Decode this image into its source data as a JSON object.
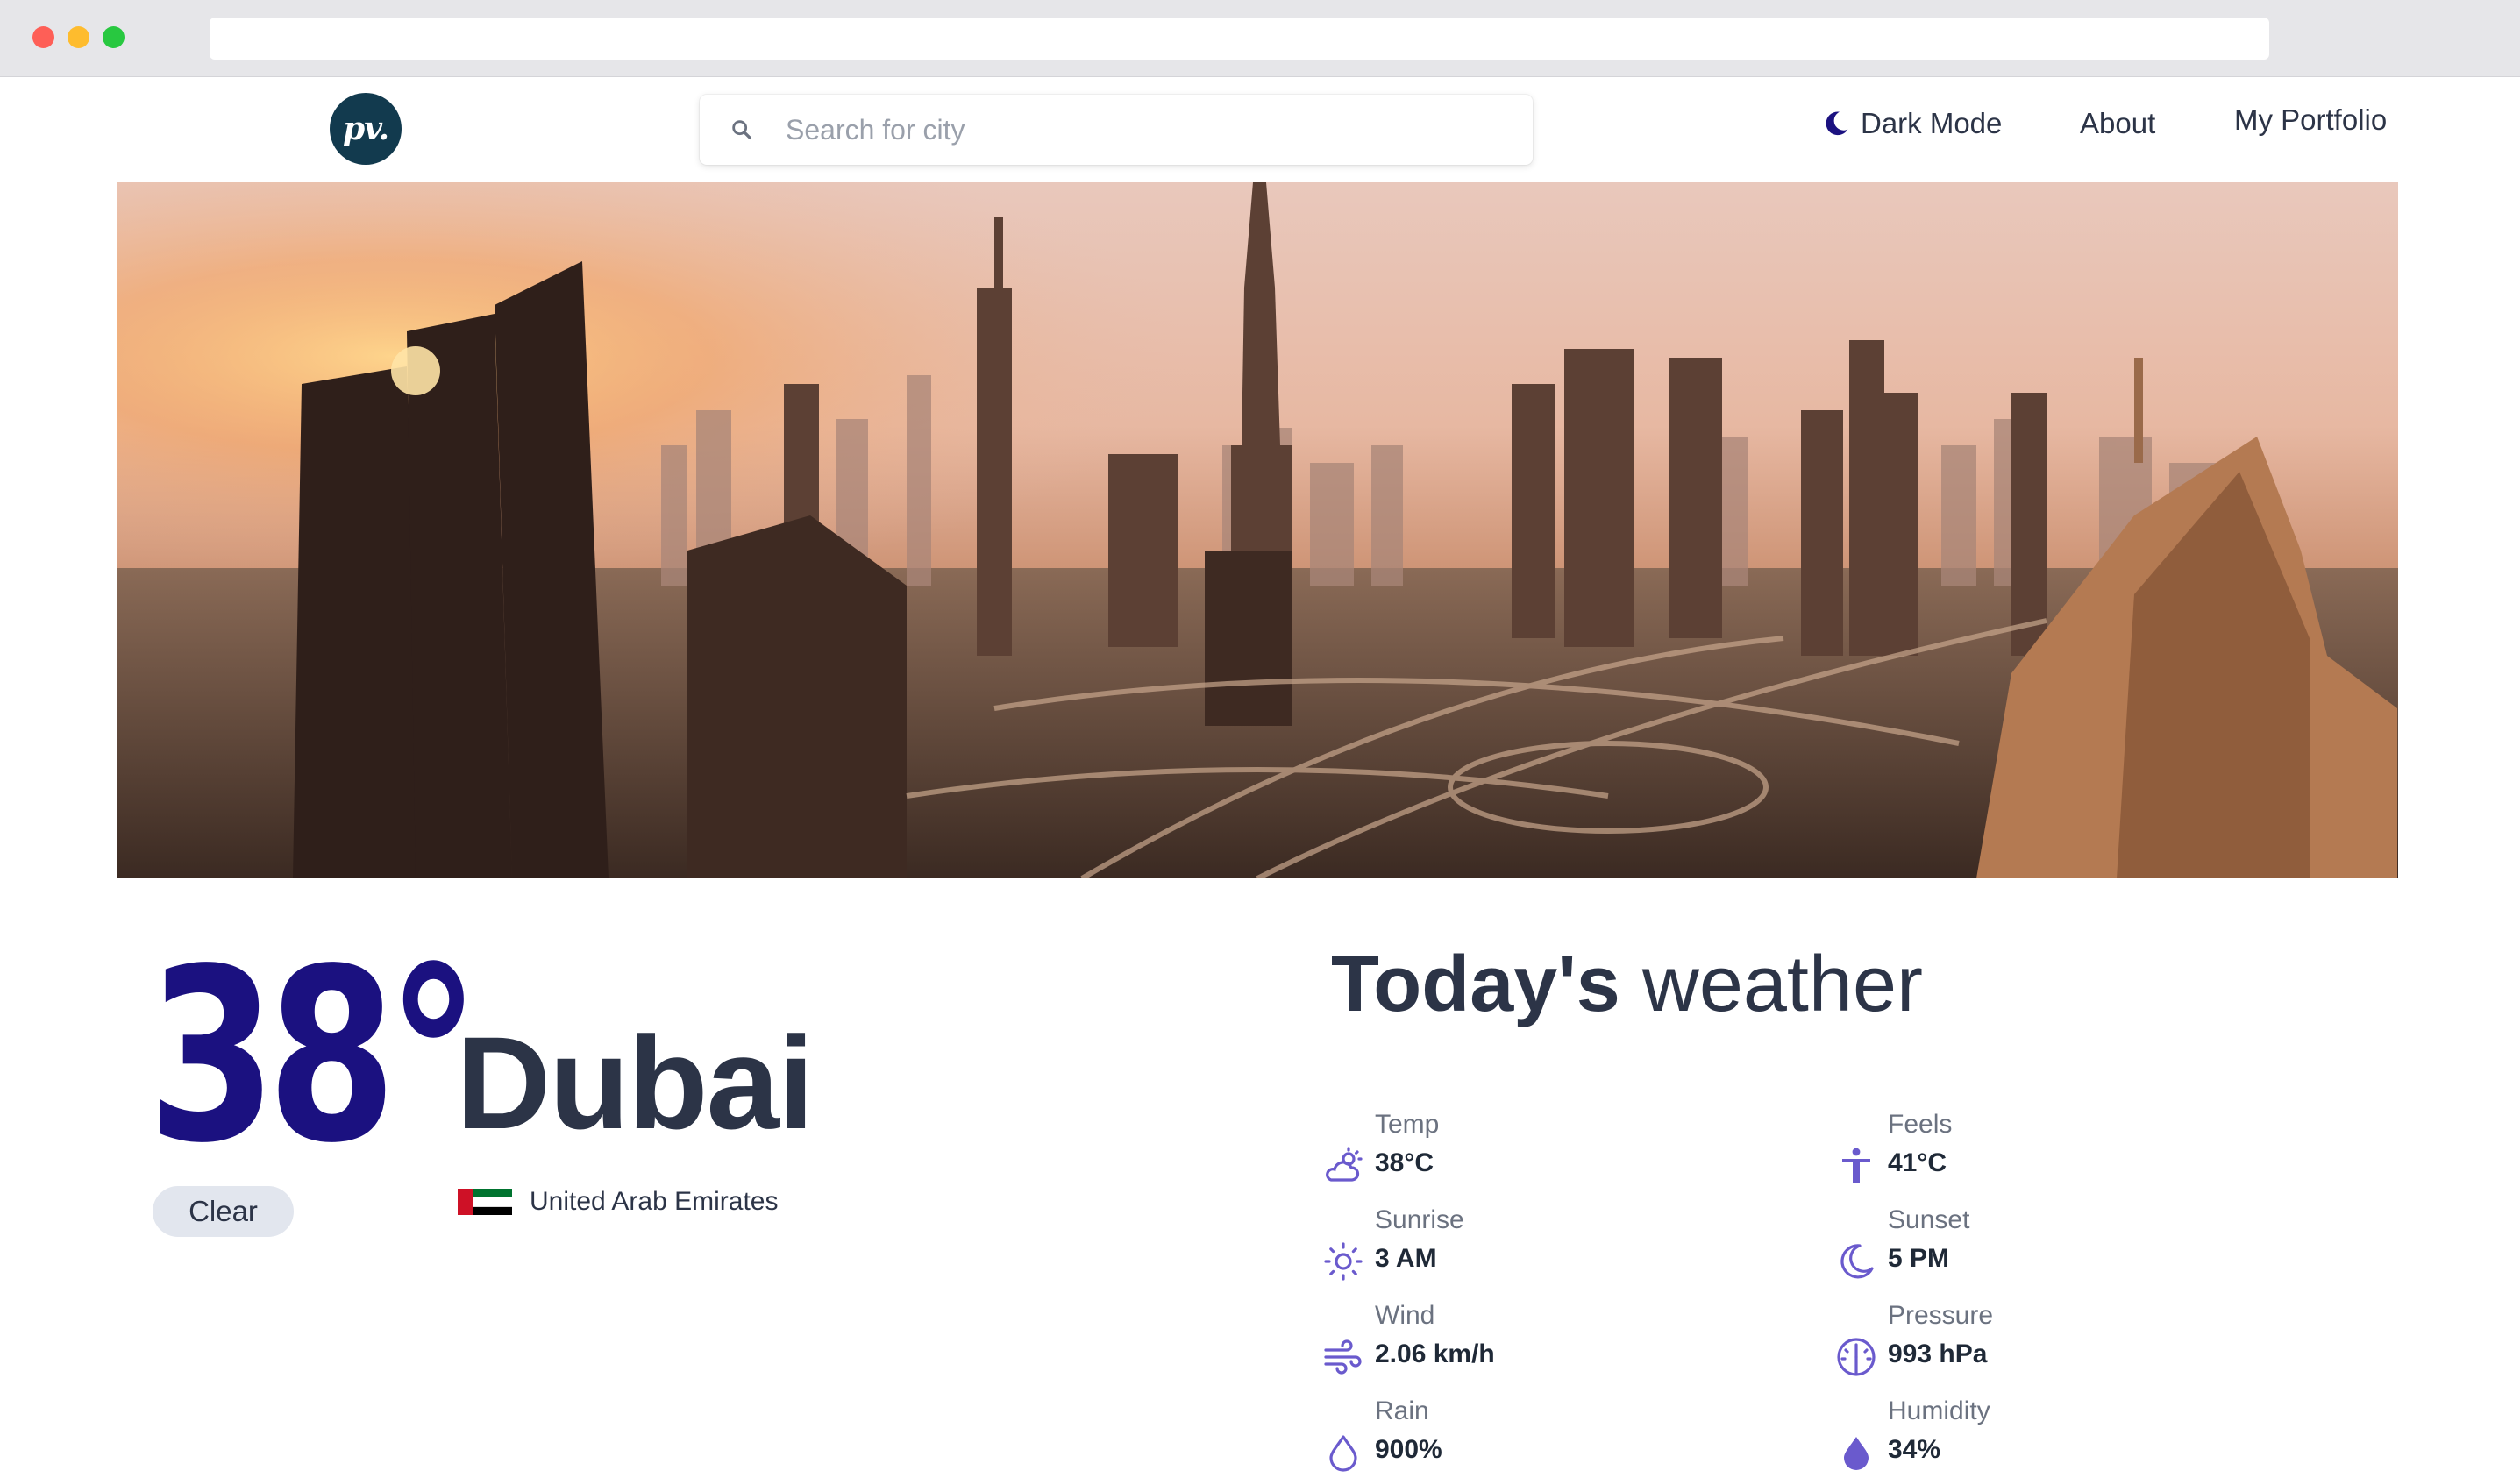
{
  "nav": {
    "logo_text": "pv.",
    "search_placeholder": "Search for city",
    "dark_mode_label": "Dark Mode",
    "about_label": "About",
    "portfolio_label": "My Portfolio"
  },
  "current": {
    "temperature": "38°",
    "city": "Dubai",
    "condition": "Clear",
    "country": "United Arab Emirates"
  },
  "today": {
    "title_bold": "Today's",
    "title_rest": " weather",
    "stats": [
      {
        "label": "Temp",
        "value": "38°C",
        "icon": "partly-cloudy-icon"
      },
      {
        "label": "Feels",
        "value": "41°C",
        "icon": "person-icon"
      },
      {
        "label": "Sunrise",
        "value": "3 AM",
        "icon": "sun-icon"
      },
      {
        "label": "Sunset",
        "value": "5 PM",
        "icon": "moon-icon"
      },
      {
        "label": "Wind",
        "value": "2.06 km/h",
        "icon": "wind-icon"
      },
      {
        "label": "Pressure",
        "value": "993 hPa",
        "icon": "gauge-icon"
      },
      {
        "label": "Rain",
        "value": "900%",
        "icon": "droplet-icon"
      },
      {
        "label": "Humidity",
        "value": "34%",
        "icon": "humidity-icon"
      }
    ]
  },
  "colors": {
    "accent": "#1b1180",
    "icon": "#6a5acd",
    "text": "#2c3447",
    "badge_bg": "#e2e6ee",
    "logo_bg": "#123a4e"
  }
}
